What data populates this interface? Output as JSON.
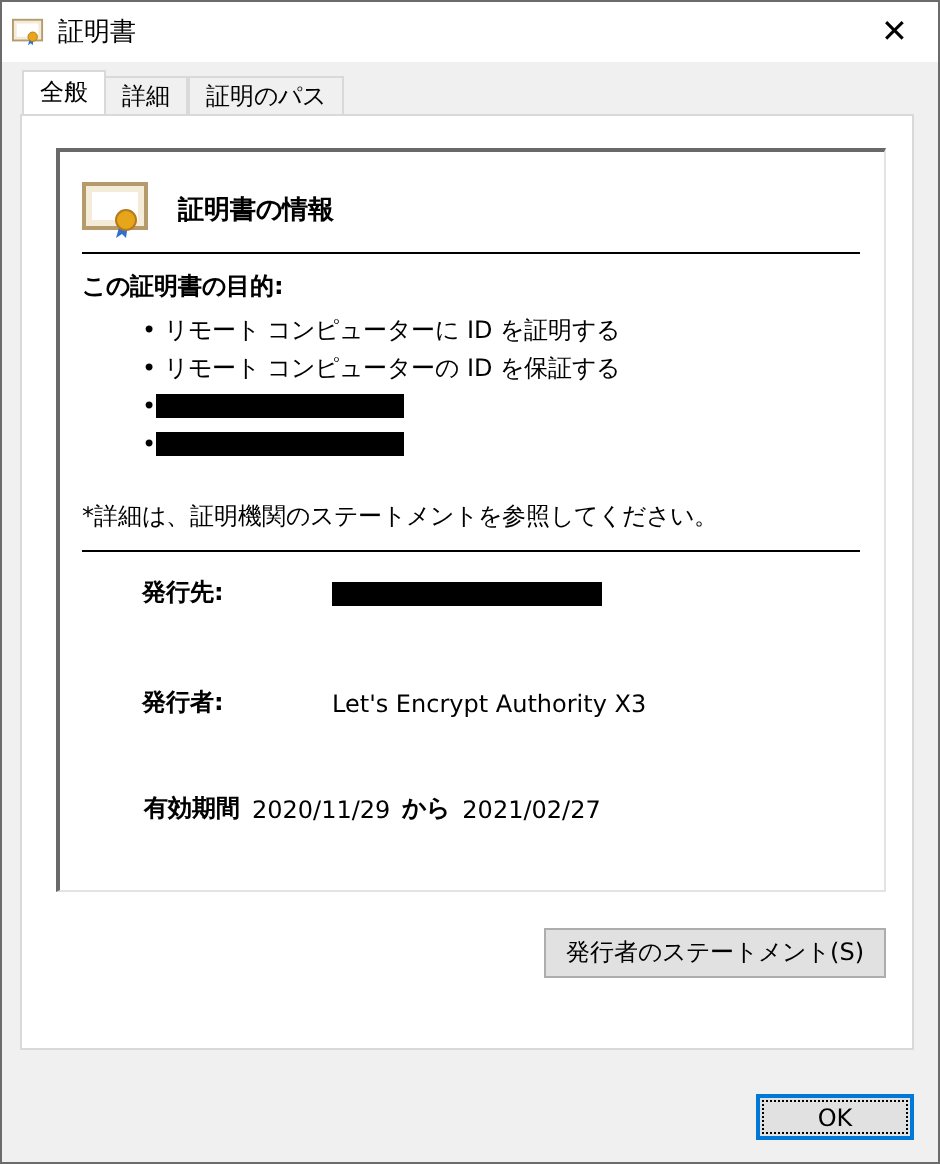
{
  "window": {
    "title": "証明書",
    "close": "✕"
  },
  "tabs": [
    {
      "label": "全般",
      "selected": true
    },
    {
      "label": "詳細",
      "selected": false
    },
    {
      "label": "証明のパス",
      "selected": false
    }
  ],
  "certificate": {
    "heading": "証明書の情報",
    "purpose_label": "この証明書の目的:",
    "purposes": [
      {
        "kind": "text",
        "text": "• リモート コンピューターに ID を証明する"
      },
      {
        "kind": "text",
        "text": "• リモート コンピューターの ID を保証する"
      },
      {
        "kind": "redacted",
        "text": "•"
      },
      {
        "kind": "redacted",
        "text": "•"
      }
    ],
    "note": "*詳細は、証明機関のステートメントを参照してください。",
    "fields": [
      {
        "label": "発行先:",
        "kind": "redacted"
      },
      {
        "label": "発行者:",
        "kind": "text",
        "value": "Let's Encrypt Authority X3"
      }
    ],
    "validity": {
      "label": "有効期間",
      "from": "2020/11/29",
      "separator": "から",
      "to": "2021/02/27"
    }
  },
  "statement_button": "発行者のステートメント(S)",
  "buttons": [
    "OK"
  ]
}
